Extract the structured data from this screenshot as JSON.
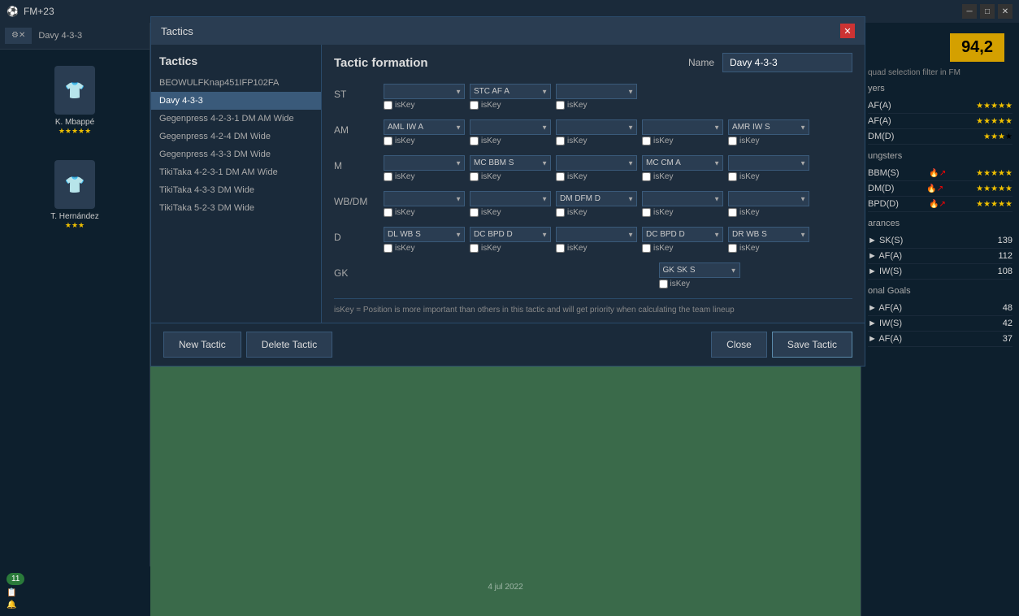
{
  "app": {
    "title": "FM+23",
    "top_label": "Davy 4-3-3"
  },
  "modal": {
    "title": "Tactics",
    "section_title": "Tactics",
    "close_icon": "✕",
    "formation_title": "Tactic formation",
    "name_label": "Name",
    "name_value": "Davy 4-3-3"
  },
  "tactics_list": [
    {
      "label": "BEOWULFKnap451IFP102FA",
      "active": false
    },
    {
      "label": "Davy 4-3-3",
      "active": true
    },
    {
      "label": "Gegenpress 4-2-3-1 DM AM Wide",
      "active": false
    },
    {
      "label": "Gegenpress 4-2-4 DM Wide",
      "active": false
    },
    {
      "label": "Gegenpress 4-3-3 DM Wide",
      "active": false
    },
    {
      "label": "TikiTaka 4-2-3-1 DM AM Wide",
      "active": false
    },
    {
      "label": "TikiTaka 4-3-3 DM Wide",
      "active": false
    },
    {
      "label": "TikiTaka 5-2-3 DM Wide",
      "active": false
    }
  ],
  "positions": [
    {
      "label": "ST",
      "slots": [
        {
          "value": "",
          "empty": true
        },
        {
          "value": "STC AF A"
        },
        {
          "value": "",
          "empty": true
        }
      ]
    },
    {
      "label": "AM",
      "slots": [
        {
          "value": "AML IW A"
        },
        {
          "value": "",
          "empty": true
        },
        {
          "value": "",
          "empty": true
        },
        {
          "value": "",
          "empty": true
        },
        {
          "value": "AMR IW S"
        }
      ]
    },
    {
      "label": "M",
      "slots": [
        {
          "value": "",
          "empty": true
        },
        {
          "value": "MC BBM S"
        },
        {
          "value": "",
          "empty": true
        },
        {
          "value": "MC CM A"
        },
        {
          "value": "",
          "empty": true
        }
      ]
    },
    {
      "label": "WB/DM",
      "slots": [
        {
          "value": "",
          "empty": true
        },
        {
          "value": "",
          "empty": true
        },
        {
          "value": "DM DFM D"
        },
        {
          "value": "",
          "empty": true
        },
        {
          "value": "",
          "empty": true
        }
      ]
    },
    {
      "label": "D",
      "slots": [
        {
          "value": "DL WB S"
        },
        {
          "value": "DC BPD D"
        },
        {
          "value": "",
          "empty": true
        },
        {
          "value": "DC BPD D"
        },
        {
          "value": "DR WB S"
        }
      ]
    },
    {
      "label": "GK",
      "slots": [
        {
          "value": "GK SK S",
          "center": true
        }
      ]
    }
  ],
  "footer_note": "isKey = Position is more important than others in this tactic and will get priority when calculating the team lineup",
  "buttons": {
    "new_tactic": "New Tactic",
    "delete_tactic": "Delete Tactic",
    "close": "Close",
    "save_tactic": "Save Tactic"
  },
  "right_panel": {
    "score": "94,2",
    "filter_label": "quad selection filter in FM",
    "sections": [
      {
        "title": "yers",
        "items": [
          {
            "label": "AF(A)",
            "stars": 5,
            "extra": ""
          },
          {
            "label": "AF(A)",
            "stars": 5,
            "extra": ""
          },
          {
            "label": "DM(D)",
            "stars": 3,
            "extra": "★"
          }
        ]
      },
      {
        "title": "ungsters",
        "items": [
          {
            "label": "BBM(S)",
            "stars": 5,
            "fire": true
          },
          {
            "label": "DM(D)",
            "stars": 5,
            "fire": true
          },
          {
            "label": "BPD(D)",
            "stars": 5,
            "fire": true
          }
        ]
      },
      {
        "title": "arances",
        "items": [
          {
            "label": "SK(S)",
            "val": "139"
          },
          {
            "label": "AF(A)",
            "val": "112"
          },
          {
            "label": "IW(S)",
            "val": "108"
          }
        ]
      },
      {
        "title": "onal Goals",
        "items": [
          {
            "label": "AF(A)",
            "val": "48"
          },
          {
            "label": "IW(S)",
            "val": "42"
          },
          {
            "label": "AF(A)",
            "val": "37"
          }
        ]
      }
    ]
  }
}
